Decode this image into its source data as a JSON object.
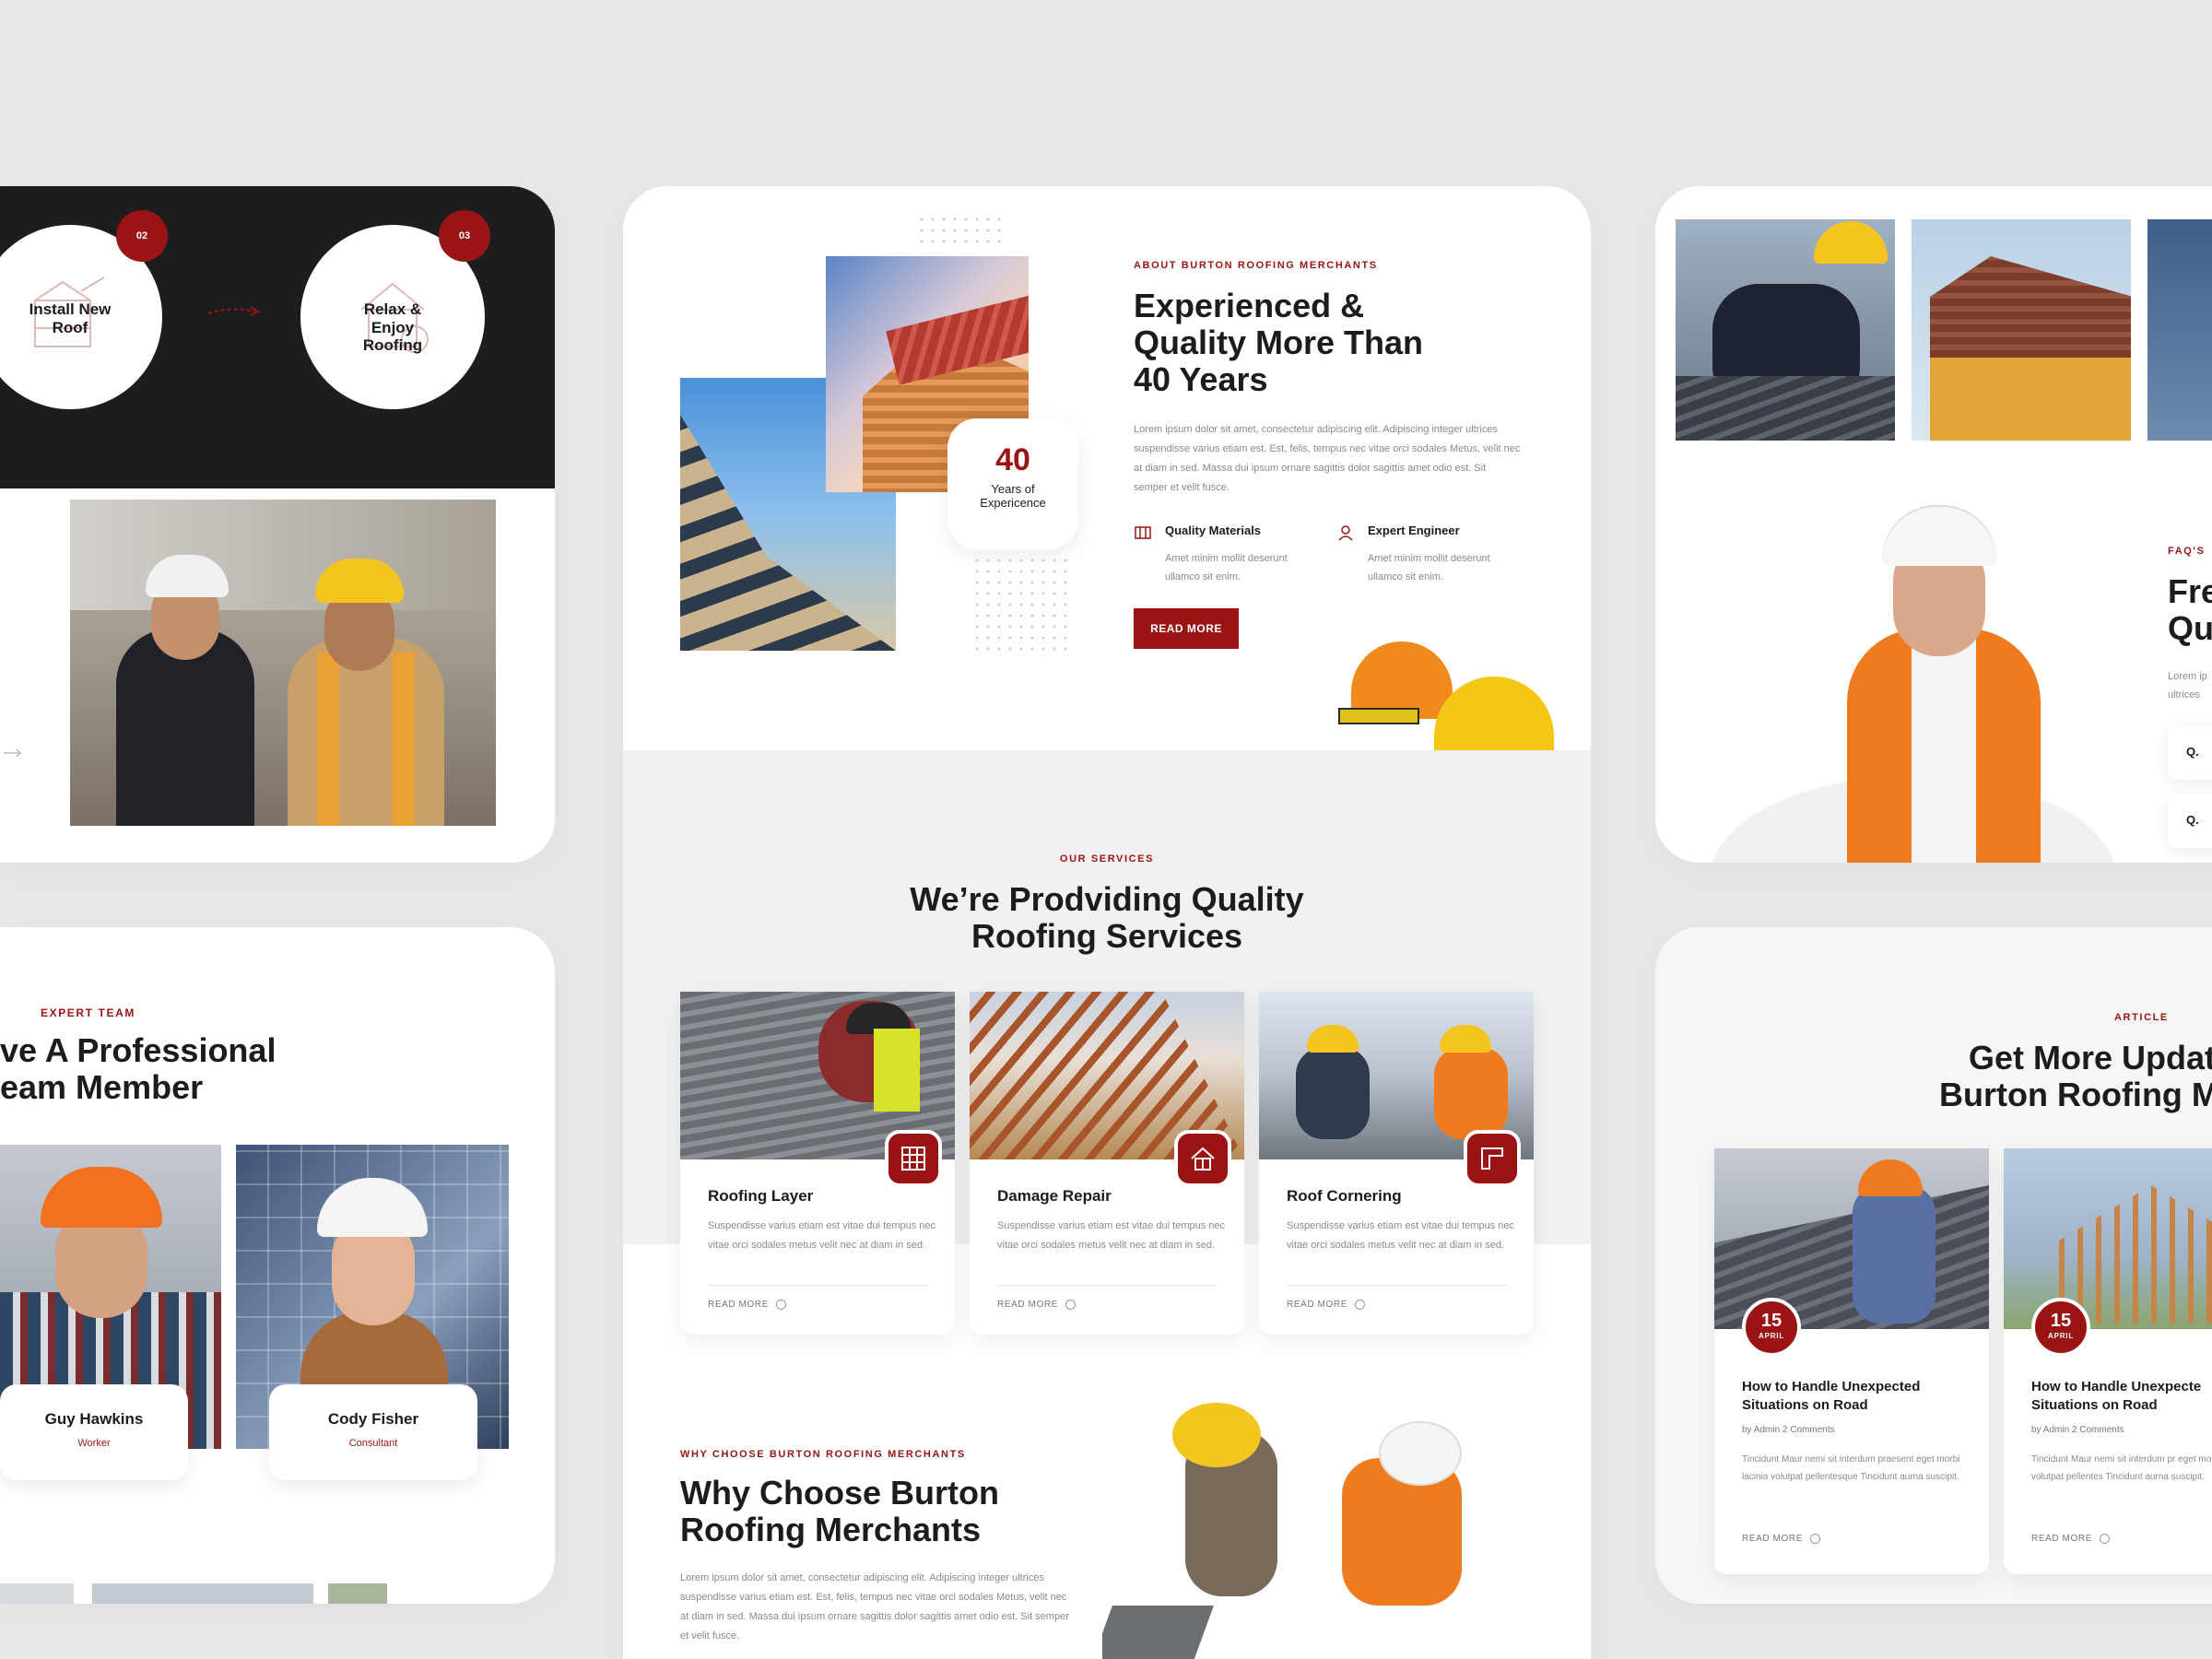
{
  "process": {
    "step2": {
      "num": "02",
      "label": "Install New Roof"
    },
    "step3": {
      "num": "03",
      "label": "Relax & Enjoy Roofing"
    }
  },
  "team": {
    "eyebrow": "EXPERT TEAM",
    "title_line1": "ve A Professional",
    "title_line2": "eam Member",
    "members": [
      {
        "name": "Guy Hawkins",
        "role": "Worker"
      },
      {
        "name": "Cody Fisher",
        "role": "Consultant"
      }
    ]
  },
  "about": {
    "eyebrow": "ABOUT BURTON ROOFING MERCHANTS",
    "title_line1": "Experienced &",
    "title_line2": "Quality More Than",
    "title_line3": "40 Years",
    "paragraph": "Lorem ipsum dolor sit amet, consectetur adipiscing elit. Adipiscing integer ultrices suspendisse varius etiam est. Est, felis, tempus nec vitae orci sodales Metus, velit nec at diam in sed. Massa dui ipsum ornare sagittis dolor sagittis amet odio est. Sit semper et velit fusce.",
    "experience_number": "40",
    "experience_label_line1": "Years of",
    "experience_label_line2": "Expericence",
    "features": [
      {
        "title": "Quality Materials",
        "text_line1": "Amet minim mollit deserunt",
        "text_line2": "ullamco sit enim."
      },
      {
        "title": "Expert Engineer",
        "text_line1": "Amet minim mollit deserunt",
        "text_line2": "ullamco sit enim."
      }
    ],
    "button": "READ MORE"
  },
  "services": {
    "eyebrow": "OUR SERVICES",
    "title_line1": "We’re Prodviding Quality",
    "title_line2": "Roofing Services",
    "items": [
      {
        "title": "Roofing Layer",
        "text": "Suspendisse varius etiam est vitae dui tempus nec vitae orci sodales metus velit nec at diam in sed.",
        "more": "READ MORE"
      },
      {
        "title": "Damage Repair",
        "text": "Suspendisse varius etiam est vitae dui tempus nec vitae orci sodales metus velit nec at diam in sed.",
        "more": "READ MORE"
      },
      {
        "title": "Roof Cornering",
        "text": "Suspendisse varius etiam est vitae dui tempus nec vitae orci sodales metus velit nec at diam in sed.",
        "more": "READ MORE"
      }
    ]
  },
  "why": {
    "eyebrow": "WHY CHOOSE BURTON ROOFING MERCHANTS",
    "title_line1": "Why Choose Burton",
    "title_line2": "Roofing Merchants",
    "paragraph": "Lorem ipsum dolor sit amet, consectetur adipiscing elit. Adipiscing integer ultrices suspendisse varius etiam est. Est, felis, tempus nec vitae orci sodales Metus, velit nec at diam in sed. Massa dui ipsum ornare sagittis dolor sagittis amet odio est. Sit semper et velit fusce."
  },
  "faq": {
    "eyebrow": "FAQ'S",
    "title_line1": "Fre",
    "title_line2": "Qu",
    "para_line1": "Lorem ip",
    "para_line2": "ultrices",
    "q1": "Q.",
    "q2": "Q."
  },
  "articles": {
    "eyebrow": "ARTICLE",
    "title_line1": "Get More Update",
    "title_line2": "Burton Roofing Me",
    "posts": [
      {
        "day": "15",
        "month": "APRIL",
        "title_line1": "How to Handle Unexpected",
        "title_line2": "Situations on Road",
        "meta": "by Admin 2 Comments",
        "text": "Tincidunt Maur nemi sit interdum praesent eget morbi lacinia volutpat pellentesque Tincidunt aurna suscipit.",
        "more": "READ MORE"
      },
      {
        "day": "15",
        "month": "APRIL",
        "title_line1": "How to Handle Unexpecte",
        "title_line2": "Situations on Road",
        "meta": "by Admin 2 Comments",
        "text": "Tincidunt Maur nemi sit interdum pr eget morbi lacinia volutpat pellentes Tincidunt aurna suscipit.",
        "more": "READ MORE"
      }
    ]
  },
  "colors": {
    "accent": "#9b1414",
    "background": "#e8e8e9",
    "text": "#1c1c1c"
  }
}
